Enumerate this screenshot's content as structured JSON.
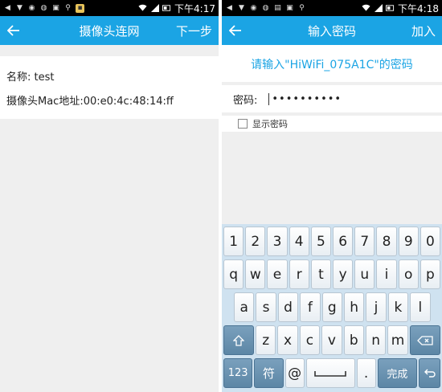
{
  "left": {
    "status": {
      "time": "下午4:17"
    },
    "appbar": {
      "title": "摄像头连网",
      "next_label": "下一步"
    },
    "info": {
      "name_line": "名称: test",
      "mac_line": "摄像头Mac地址:00:e0:4c:48:14:ff"
    }
  },
  "right": {
    "status": {
      "time": "下午4:18"
    },
    "appbar": {
      "title": "输入密码",
      "join_label": "加入"
    },
    "prompt": "请输入\"HiWiFi_075A1C\"的密码",
    "password": {
      "label": "密码:",
      "masked_value": "••••••••••"
    },
    "show_password_label": "显示密码",
    "keyboard": {
      "numbers": [
        "1",
        "2",
        "3",
        "4",
        "5",
        "6",
        "7",
        "8",
        "9",
        "0"
      ],
      "row1": [
        "q",
        "w",
        "e",
        "r",
        "t",
        "y",
        "u",
        "i",
        "o",
        "p"
      ],
      "row2": [
        "a",
        "s",
        "d",
        "f",
        "g",
        "h",
        "j",
        "k",
        "l"
      ],
      "row3": [
        "z",
        "x",
        "c",
        "v",
        "b",
        "n",
        "m"
      ],
      "row4": {
        "mode": "123",
        "symbol": "符",
        "at": "@",
        "dot": ".",
        "done": "完成"
      }
    }
  },
  "colors": {
    "accent": "#1ba4e4",
    "statusbar": "#000000",
    "page_bg": "#efefef"
  }
}
